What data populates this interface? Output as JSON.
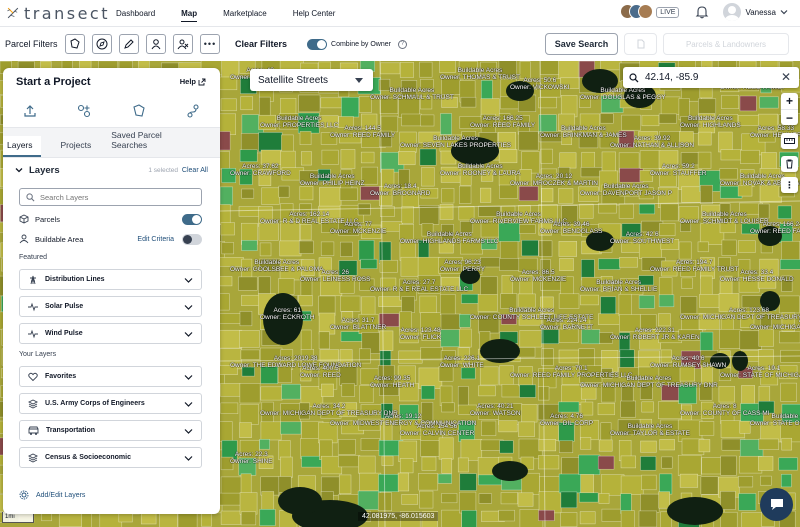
{
  "brand": {
    "name": "transect"
  },
  "nav": {
    "links": [
      "Dashboard",
      "Map",
      "Marketplace",
      "Help Center"
    ],
    "active": "Map",
    "live_badge": "LIVE",
    "user_name": "Vanessa"
  },
  "filters": {
    "label": "Parcel Filters",
    "clear_label": "Clear Filters",
    "combine_label": "Combine by Owner",
    "combine_on": true,
    "save_search_label": "Save Search",
    "parcels_landowners_label": "Parcels & Landowners"
  },
  "panel": {
    "title": "Start a Project",
    "help_label": "Help",
    "tabs": [
      "Layers",
      "Projects",
      "Saved Parcel Searches"
    ],
    "active_tab": "Layers",
    "layers_title": "Layers",
    "selected_text": "1 selected",
    "clear_all": "Clear All",
    "search_placeholder": "Search Layers",
    "parcels_label": "Parcels",
    "buildable_label": "Buildable Area",
    "edit_criteria": "Edit Criteria",
    "featured_label": "Featured",
    "featured": [
      "Distribution Lines",
      "Solar Pulse",
      "Wind Pulse"
    ],
    "your_layers_label": "Your Layers",
    "your_layers": [
      "Favorites",
      "U.S. Army Corps of Engineers",
      "Transportation",
      "Census & Socioeconomic"
    ],
    "add_edit_layers": "Add/Edit Layers"
  },
  "map": {
    "style_select": "Satellite Streets",
    "coord_search_value": "42.14, -85.9",
    "scale_label": "1mi",
    "cursor_coords": "42.081975, -86.015603",
    "parcel_labels": [
      {
        "owner": "HEMENWAY",
        "extra": "Acres: 40"
      },
      {
        "owner": "ZWARTZ",
        "extra": "Acres: 22"
      },
      {
        "owner": "SCHMAUL & TRUST",
        "extra": "Buildable Acres"
      },
      {
        "owner": "THOMAS & TRUST",
        "extra": "Buildable Acres"
      },
      {
        "owner": "VICKOWSKI",
        "extra": "Acres: 50.6"
      },
      {
        "owner": "DOUGLAS & PEGGY",
        "extra": "Buildable Acres"
      },
      {
        "owner": "MARVIN & MARLANE",
        "extra": "Acres: 32"
      },
      {
        "owner": "REED FAMILY",
        "extra": "Acres: 99.88"
      },
      {
        "owner": "PROPERTIES LLC",
        "extra": "Buildable Acres"
      },
      {
        "owner": "REED FAMILY",
        "extra": "Acres: 144.5"
      },
      {
        "owner": "SEVEN LAKES PROPERTIES",
        "extra": "Buildable Acres"
      },
      {
        "owner": "REED FAMILY",
        "extra": "Acres: 166.25"
      },
      {
        "owner": "BRINKMAN & JAMES",
        "extra": "Buildable Acres"
      },
      {
        "owner": "NATHAN & ALLISON",
        "extra": "Acres: 39.92"
      },
      {
        "owner": "HIGHLANDS",
        "extra": "Buildable Acres"
      },
      {
        "owner": "HEMMER",
        "extra": "Acres: 58.33"
      },
      {
        "owner": "CRAWFORD",
        "extra": "Acres: 37.62"
      },
      {
        "owner": "PHILIP HEINZ",
        "extra": "Buildable Acres"
      },
      {
        "owner": "BROGNARD",
        "extra": "Acres: 18.4"
      },
      {
        "owner": "ROONEY & LAURA",
        "extra": "Buildable Acres"
      },
      {
        "owner": "MROCZEK & MARTIN",
        "extra": "Acres: 20.12"
      },
      {
        "owner": "DAVENPORT JASON P",
        "extra": "Buildable Acres"
      },
      {
        "owner": "STAUFFER",
        "extra": "Acres: 59.2"
      },
      {
        "owner": "NOVAK & ABRAHAM",
        "extra": "Buildable Acres"
      },
      {
        "owner": "R & D REAL ESTATE LLC",
        "extra": "Acres: 162.14"
      },
      {
        "owner": "MCKENZIE",
        "extra": "Acres: 77"
      },
      {
        "owner": "HIGHLANDS FARMS LLC",
        "extra": "Buildable Acres"
      },
      {
        "owner": "RIVERVIEW FARMS LLC",
        "extra": "Buildable Acres"
      },
      {
        "owner": "BENDGLASS",
        "extra": "Acres: 39.46"
      },
      {
        "owner": "SOUTHWEST",
        "extra": "Acres: 42.6"
      },
      {
        "owner": "SCHMIDT & LOUISER",
        "extra": "Buildable Acres"
      },
      {
        "owner": "REED FAMILY",
        "extra": "Acres: 166.24"
      },
      {
        "owner": "GOOLSBEE & PALOMA",
        "extra": "Buildable Acres"
      },
      {
        "owner": "LEINESS ROSS",
        "extra": "Acres: 26"
      },
      {
        "owner": "R & E REAL ESTATE LLC",
        "extra": "Acres: 27.7"
      },
      {
        "owner": "PERRY",
        "extra": "Acres: 96.23"
      },
      {
        "owner": "MCKENZIE",
        "extra": "Acres: 86.5"
      },
      {
        "owner": "BRIAN & SHELLIE",
        "extra": "Buildable Acres"
      },
      {
        "owner": "REED FAMILY TRUST",
        "extra": "Acres: 194.7"
      },
      {
        "owner": "HESSE DONALD",
        "extra": "Acres: 33.4"
      },
      {
        "owner": "ECKROTH",
        "extra": "Acres: 61"
      },
      {
        "owner": "BLATTNER",
        "extra": "Acres: 31.7"
      },
      {
        "owner": "FLICK",
        "extra": "Acres: 123.48"
      },
      {
        "owner": "COUNTY SCHLEET LIFE ESTATE",
        "extra": "Buildable Acres"
      },
      {
        "owner": "BARNETT",
        "extra": "Acres: 224.24"
      },
      {
        "owner": "ROBERT JR & KAREN",
        "extra": "Acres: 222.31"
      },
      {
        "owner": "MICHIGAN DEPT OF TREASURY DNR",
        "extra": "Acres: 123.68"
      },
      {
        "owner": "MICHIGAN DEPT OF TREASURY DNR",
        "extra": "Acres: 102.43"
      },
      {
        "owner": "THE EDWARD LOWE FOUNDATION",
        "extra": "Acres: 2019.38"
      },
      {
        "owner": "REED",
        "extra": "Acres: 400.5"
      },
      {
        "owner": "HEATH",
        "extra": "Acres: 99.35"
      },
      {
        "owner": "WHITE",
        "extra": "Acres: 226.1"
      },
      {
        "owner": "REED FAMILY PROPERTIES LLC",
        "extra": "Acres: 70.1"
      },
      {
        "owner": "MICHIGAN DEPT OF TREASURY DNR",
        "extra": "Buildable Acres"
      },
      {
        "owner": "RUMSEY SHAWN",
        "extra": "Acres: 40.6"
      },
      {
        "owner": "STATE OF MICHIGAN",
        "extra": "Acres: 19.1"
      },
      {
        "owner": "MICHIGAN DEPT OF TREASURY DNR",
        "extra": "Acres: 34.2"
      },
      {
        "owner": "MIDWEST ENERGY & COMMUNICATION",
        "extra": "Acres: 19.12"
      },
      {
        "owner": "CALVIN CENTER",
        "extra": "Acres: 154.56"
      },
      {
        "owner": "WATSON",
        "extra": "Acres: 40.21"
      },
      {
        "owner": "DIL CORP",
        "extra": "Acres: 4.76"
      },
      {
        "owner": "TAYLOR & ESTATE",
        "extra": "Buildable Acres"
      },
      {
        "owner": "COUNTY OF CASS MI",
        "extra": "Acres: 8"
      },
      {
        "owner": "STATE OF MICHIGAN",
        "extra": "Buildable Acres"
      },
      {
        "owner": "SHINE",
        "extra": "Acres: 22.3"
      }
    ]
  },
  "colors": {
    "accent": "#3f6b8a",
    "link": "#1f4e79",
    "parcel_yellow": "#b5b23a",
    "parcel_green": "#2e9a4a",
    "forest_dark": "#102012",
    "chat_bubble": "#1f3b5c"
  },
  "icons": {
    "filter": [
      "polygon-draw-icon",
      "compass-icon",
      "pencil-icon",
      "person-icon",
      "people-icon",
      "more-icon"
    ],
    "project_tools": [
      "upload-icon",
      "add-shape-icon",
      "map-shape-icon",
      "route-icon"
    ]
  }
}
